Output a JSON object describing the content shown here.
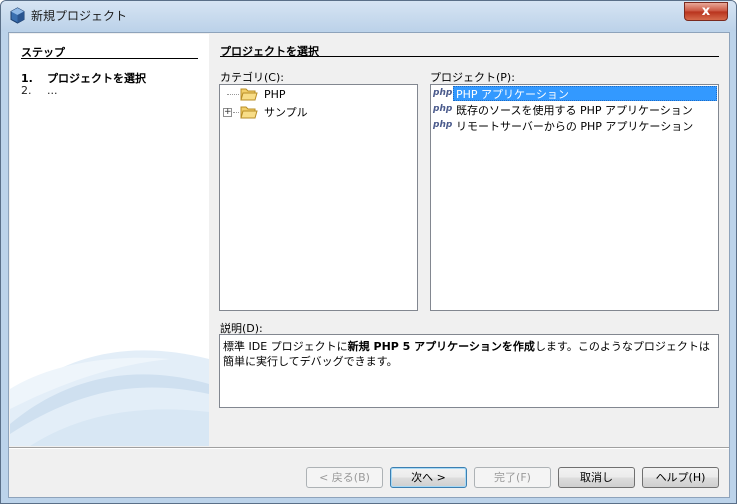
{
  "window": {
    "title": "新規プロジェクト",
    "close_label": "x"
  },
  "steps": {
    "title": "ステップ",
    "items": [
      {
        "num": "1.",
        "label": "プロジェクトを選択"
      },
      {
        "num": "2.",
        "label": "..."
      }
    ]
  },
  "content": {
    "title": "プロジェクトを選択",
    "category_label": "カテゴリ(C):",
    "project_label": "プロジェクト(P):",
    "description_label": "説明(D):",
    "categories": [
      {
        "label": "PHP",
        "icon": "folder-icon"
      },
      {
        "label": "サンプル",
        "icon": "folder-icon",
        "expandable": "+"
      }
    ],
    "projects": [
      {
        "label": "PHP アプリケーション",
        "icon": "php",
        "selected": true
      },
      {
        "label": "既存のソースを使用する PHP アプリケーション",
        "icon": "php"
      },
      {
        "label": "リモートサーバーからの PHP アプリケーション",
        "icon": "php"
      }
    ],
    "description": {
      "pre": "標準 IDE プロジェクトに",
      "bold": "新規 PHP 5 アプリケーションを作成",
      "post": "します。このようなプロジェクトは簡単に実行してデバッグできます。"
    }
  },
  "buttons": {
    "back": "< 戻る(B)",
    "next": "次へ >",
    "finish": "完了(F)",
    "cancel": "取消し",
    "help": "ヘルプ(H)"
  },
  "colors": {
    "selection": "#3399ff",
    "title_bar": "#bcd2e9"
  }
}
